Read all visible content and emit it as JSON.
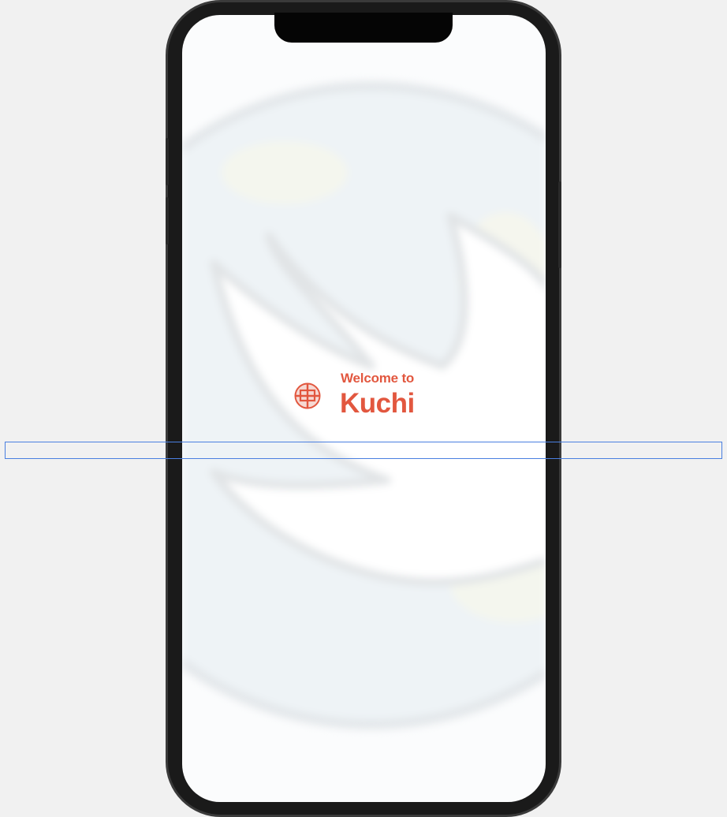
{
  "welcome": {
    "greeting": "Welcome to",
    "app_name": "Kuchi"
  },
  "icons": {
    "logo": "kuchi-logo-icon",
    "background": "kuchi-background-art"
  },
  "colors": {
    "accent": "#e2573f",
    "screen_background": "#fbfcfd",
    "canvas_background": "#f1f1f1",
    "selection_outline": "#4a7fe0"
  }
}
